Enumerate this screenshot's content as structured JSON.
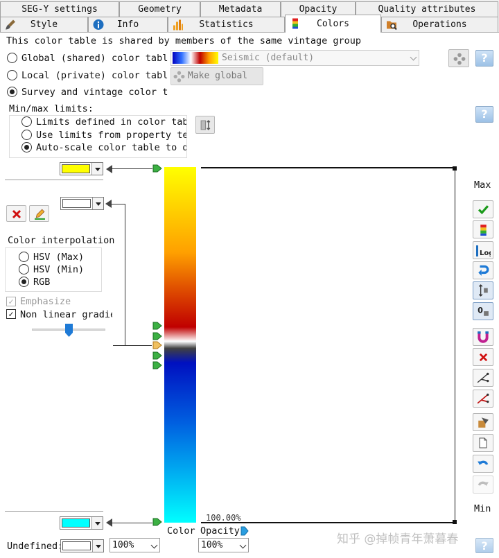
{
  "tabs_row1": [
    {
      "label": "SEG-Y settings"
    },
    {
      "label": "Geometry"
    },
    {
      "label": "Metadata"
    },
    {
      "label": "Opacity"
    },
    {
      "label": "Quality attributes"
    }
  ],
  "tabs_row2": [
    {
      "label": "Style",
      "icon": "brush-icon"
    },
    {
      "label": "Info",
      "icon": "info-icon"
    },
    {
      "label": "Statistics",
      "icon": "histogram-icon"
    },
    {
      "label": "Colors",
      "icon": "color-bar-icon",
      "active": true
    },
    {
      "label": "Operations",
      "icon": "folder-search-icon"
    }
  ],
  "shared_note": "This color table is shared by members of the same vintage group",
  "table_options": {
    "global": "Global (shared) color table",
    "local": "Local (private) color table",
    "survey": "Survey and vintage color table",
    "selected": "survey"
  },
  "color_table_select": {
    "value": "Seismic (default)"
  },
  "make_global_label": "Make global",
  "minmax": {
    "title": "Min/max limits:",
    "opt1": "Limits defined in color table",
    "opt2": "Use limits from property template",
    "opt3": "Auto-scale color table to data",
    "selected": "opt3"
  },
  "interpolation": {
    "title": "Color interpolation",
    "hsv_max": "HSV (Max)",
    "hsv_min": "HSV (Min)",
    "rgb": "RGB",
    "selected": "rgb"
  },
  "emphasize": {
    "label": "Emphasize",
    "checked": true,
    "disabled": true
  },
  "non_linear": {
    "label": "Non linear gradient",
    "checked": true
  },
  "slider_position": 0.5,
  "colors": {
    "max_swatch": "#ffff00",
    "mid_swatch": "#ffffff",
    "min_swatch": "#00ffff",
    "undefined_swatch": "#ffffff"
  },
  "labels": {
    "max": "Max",
    "min": "Min",
    "opacity_value": "100.00%",
    "color": "Color",
    "opacity": "Opacity",
    "undefined": "Undefined:"
  },
  "percent_left": "100%",
  "percent_right": "100%",
  "watermark": "知乎 @掉帧青年萧暮春"
}
